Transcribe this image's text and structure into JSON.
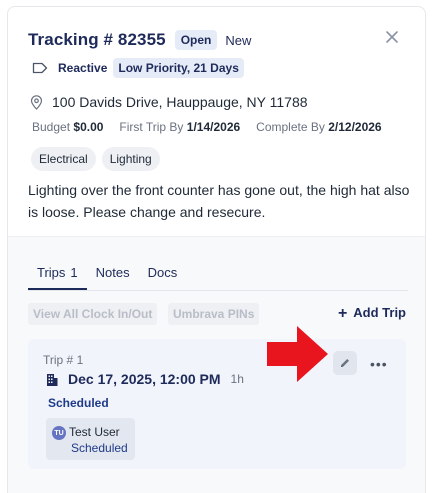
{
  "header": {
    "title": "Tracking # 82355",
    "status_badge": "Open",
    "status_sub": "New"
  },
  "tags": {
    "type": "Reactive",
    "priority": "Low Priority, 21 Days"
  },
  "location": {
    "address": "100 Davids Drive, Hauppauge, NY 11788"
  },
  "meta": {
    "budget_label": "Budget",
    "budget_value": "$0.00",
    "first_trip_label": "First Trip By",
    "first_trip_value": "1/14/2026",
    "complete_label": "Complete By",
    "complete_value": "2/12/2026"
  },
  "trades": [
    "Electrical",
    "Lighting"
  ],
  "description": "Lighting over the front counter has gone out, the high hat also is loose. Please change and resecure.",
  "tabs": [
    {
      "label": "Trips",
      "count": "1",
      "active": true
    },
    {
      "label": "Notes"
    },
    {
      "label": "Docs"
    }
  ],
  "actions": {
    "view_clock": "View All Clock In/Out",
    "pins": "Umbrava PINs",
    "add_trip": "Add Trip"
  },
  "trip": {
    "number": "Trip # 1",
    "datetime": "Dec 17, 2025, 12:00 PM",
    "duration": "1h",
    "status": "Scheduled",
    "assignee": {
      "initials": "TU",
      "name": "Test User",
      "status": "Scheduled"
    }
  },
  "colors": {
    "accent": "#1e2a5a",
    "annotation_arrow": "#e8141e"
  }
}
